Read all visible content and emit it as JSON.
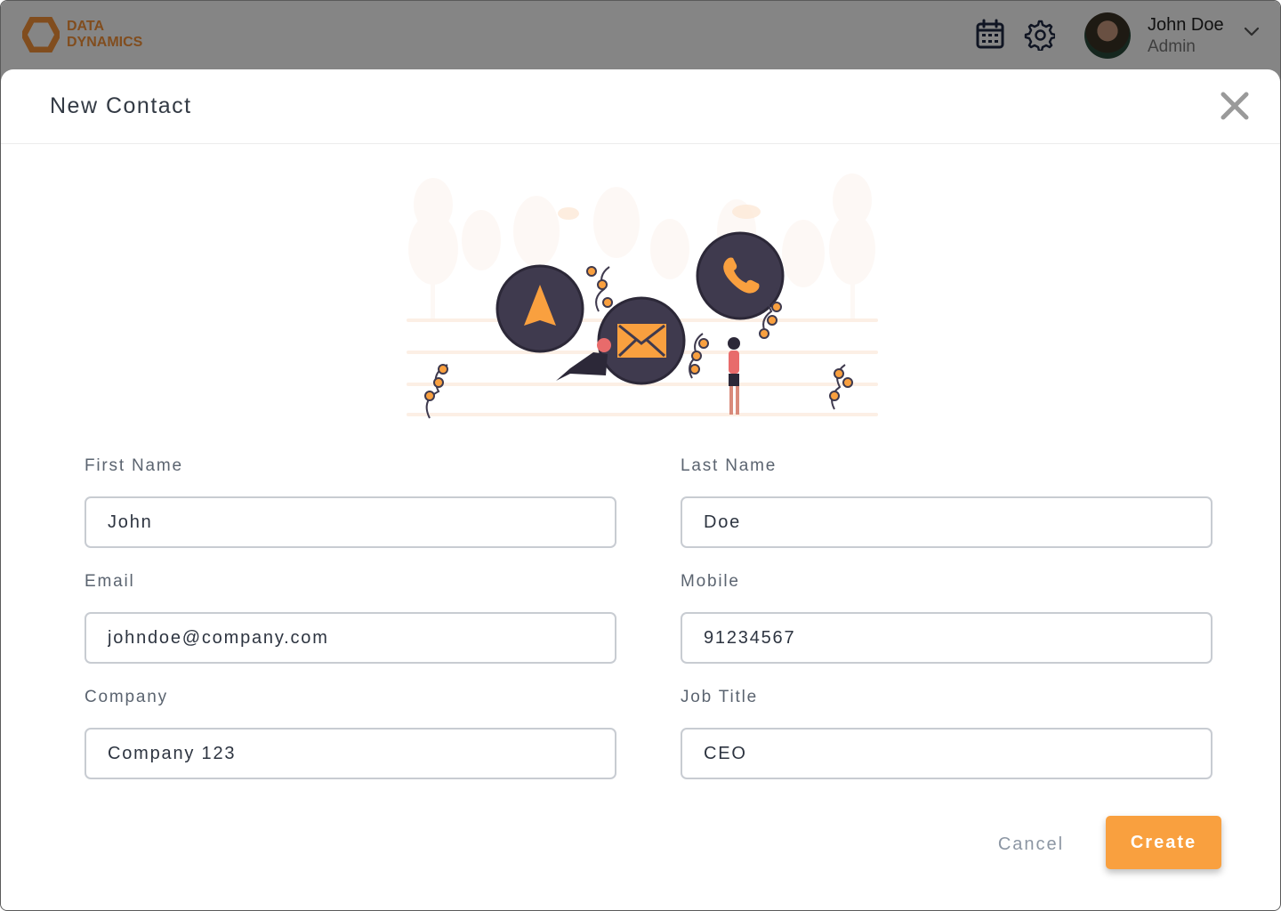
{
  "app": {
    "brand": {
      "line1": "DATA",
      "line2": "DYNAMICS",
      "icon": "hexagon-logo-icon"
    },
    "header_icons": [
      "calendar-icon",
      "gear-icon"
    ],
    "user": {
      "name": "John Doe",
      "role": "Admin",
      "avatar": "user-avatar"
    }
  },
  "modal": {
    "title": "New Contact",
    "close_icon": "close-icon",
    "illustration_icons": [
      "navigation-icon",
      "mail-icon",
      "phone-icon"
    ],
    "fields": {
      "first_name": {
        "label": "First Name",
        "value": "John"
      },
      "last_name": {
        "label": "Last Name",
        "value": "Doe"
      },
      "email": {
        "label": "Email",
        "value": "johndoe@company.com"
      },
      "mobile": {
        "label": "Mobile",
        "value": "91234567"
      },
      "company": {
        "label": "Company",
        "value": "Company 123"
      },
      "job_title": {
        "label": "Job Title",
        "value": "CEO"
      }
    },
    "actions": {
      "cancel": "Cancel",
      "create": "Create"
    }
  },
  "colors": {
    "accent": "#F9A03F",
    "overlay": "rgba(0,0,0,0.48)",
    "text_dark": "#333A44",
    "label": "#5B6470",
    "input_border": "#C8CCD2",
    "icon_bubble": "#3F3A4E"
  }
}
